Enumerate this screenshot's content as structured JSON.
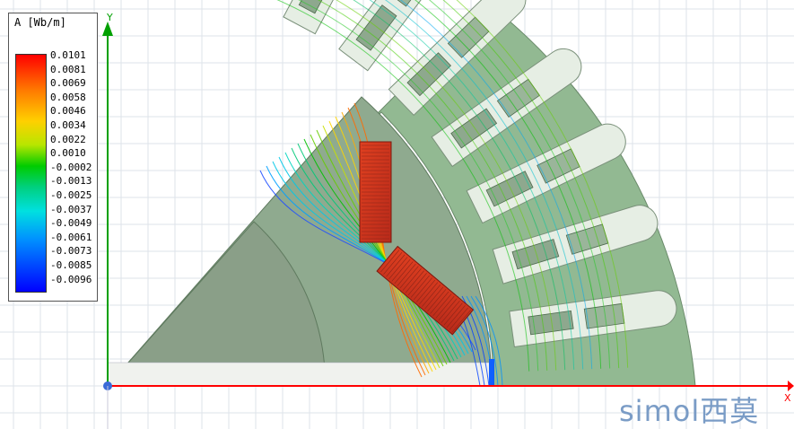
{
  "legend": {
    "title": "A [Wb/m]",
    "ticks": [
      "0.0101",
      "0.0081",
      "0.0069",
      "0.0058",
      "0.0046",
      "0.0034",
      "0.0022",
      "0.0010",
      "-0.0002",
      "-0.0013",
      "-0.0025",
      "-0.0037",
      "-0.0049",
      "-0.0061",
      "-0.0073",
      "-0.0085",
      "-0.0096"
    ]
  },
  "axes": {
    "y_label": "Y",
    "x_label": "X"
  },
  "brand": {
    "text": "simol西莫"
  },
  "colors": {
    "stator": "#90b890",
    "rotor": "#8fa88f",
    "slot": "#e8efe6",
    "coil": "#9ab09a",
    "magnet": "#d83a22",
    "axis_x": "#ff0000",
    "axis_y": "#00a000",
    "grid": "#dde3ea"
  }
}
